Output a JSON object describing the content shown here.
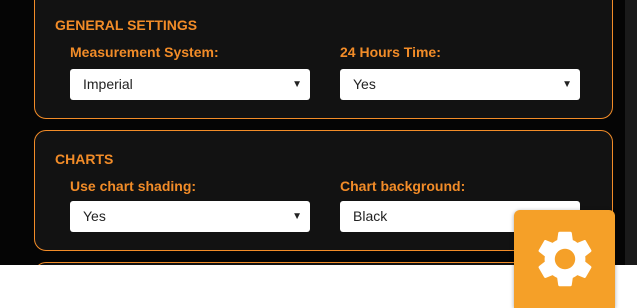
{
  "general": {
    "title": "GENERAL SETTINGS",
    "measurement_label": "Measurement System:",
    "measurement_value": "Imperial",
    "time_label": "24 Hours Time:",
    "time_value": "Yes"
  },
  "charts": {
    "title": "CHARTS",
    "shading_label": "Use chart shading:",
    "shading_value": "Yes",
    "background_label": "Chart background:",
    "background_value": "Black"
  },
  "icons": {
    "dropdown_caret": "▼",
    "settings_button": "gear-icon"
  },
  "colors": {
    "accent": "#f28c28",
    "fab": "#f5a028",
    "panel_bg": "#121212",
    "page_bg": "#050505"
  }
}
